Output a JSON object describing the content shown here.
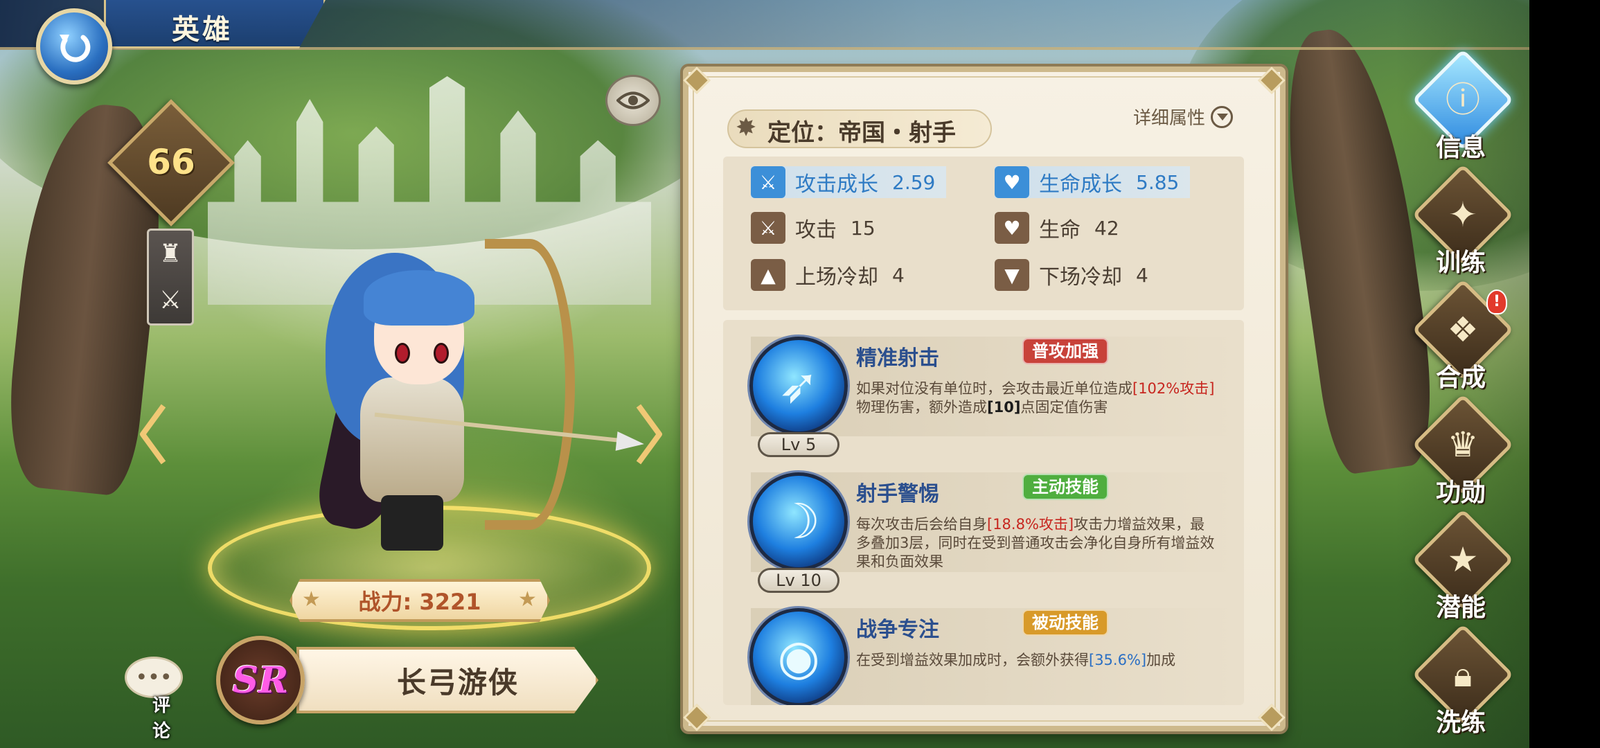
{
  "header": {
    "title": "英雄"
  },
  "hero": {
    "level": "66",
    "class_icons": [
      "tower-icon",
      "crossed-swords-icon"
    ],
    "power_label": "战力: 3221",
    "rarity": "SR",
    "name": "长弓游侠"
  },
  "comment": {
    "label": "评论"
  },
  "info": {
    "position": "定位：帝国・射手",
    "detail_label": "详细属性",
    "stats": [
      {
        "icon": "attack-growth-icon",
        "label": "攻击成长",
        "value": "2.59",
        "highlight": true
      },
      {
        "icon": "hp-growth-icon",
        "label": "生命成长",
        "value": "5.85",
        "highlight": true
      },
      {
        "icon": "attack-icon",
        "label": "攻击",
        "value": "15",
        "highlight": false
      },
      {
        "icon": "hp-icon",
        "label": "生命",
        "value": "42",
        "highlight": false
      },
      {
        "icon": "enter-cooldown-icon",
        "label": "上场冷却",
        "value": "4",
        "highlight": false
      },
      {
        "icon": "exit-cooldown-icon",
        "label": "下场冷却",
        "value": "4",
        "highlight": false
      }
    ]
  },
  "skills": [
    {
      "name": "精准射击",
      "tag": "普攻加强",
      "level": "Lv 5",
      "icon": "precision-shot-icon",
      "desc": [
        {
          "t": "如果对位没有单位时，会攻击最近单位造成",
          "c": ""
        },
        {
          "t": "[102%攻击]",
          "c": "red"
        },
        {
          "t": "物理伤害，额外造成",
          "c": ""
        },
        {
          "t": "[10]",
          "c": "bk"
        },
        {
          "t": "点固定值伤害",
          "c": ""
        }
      ]
    },
    {
      "name": "射手警惕",
      "tag": "主动技能",
      "level": "Lv 10",
      "icon": "archer-vigilance-icon",
      "desc": [
        {
          "t": "每次攻击后会给自身",
          "c": ""
        },
        {
          "t": "[18.8%攻击]",
          "c": "red"
        },
        {
          "t": "攻击力增益效果，最多叠加3层，同时在受到普通攻击会净化自身所有增益效果和负面效果",
          "c": ""
        }
      ]
    },
    {
      "name": "战争专注",
      "tag": "被动技能",
      "level": "",
      "icon": "war-focus-icon",
      "desc": [
        {
          "t": "在受到增益效果加成时，会额外获得",
          "c": ""
        },
        {
          "t": "[35.6%]",
          "c": "blue"
        },
        {
          "t": "加成",
          "c": ""
        }
      ]
    }
  ],
  "menu": [
    {
      "label": "信息",
      "icon": "info-icon",
      "active": true,
      "badge": ""
    },
    {
      "label": "训练",
      "icon": "training-icon",
      "active": false,
      "badge": ""
    },
    {
      "label": "合成",
      "icon": "synthesis-icon",
      "active": false,
      "badge": "!"
    },
    {
      "label": "功勋",
      "icon": "merit-icon",
      "active": false,
      "badge": ""
    },
    {
      "label": "潜能",
      "icon": "potential-icon",
      "active": false,
      "badge": ""
    },
    {
      "label": "洗练",
      "icon": "refine-icon",
      "active": false,
      "badge": ""
    }
  ],
  "colors": {
    "panel_bg": "#f7f1e4",
    "skill_name": "#2b4f8e",
    "tag_normal": "#c8423a",
    "tag_active": "#4fae3f",
    "tag_passive": "#d89a2a",
    "highlight_blue": "#2f7bc4",
    "highlight_red": "#c7261f",
    "rarity_pink": "#ff5ce6"
  }
}
